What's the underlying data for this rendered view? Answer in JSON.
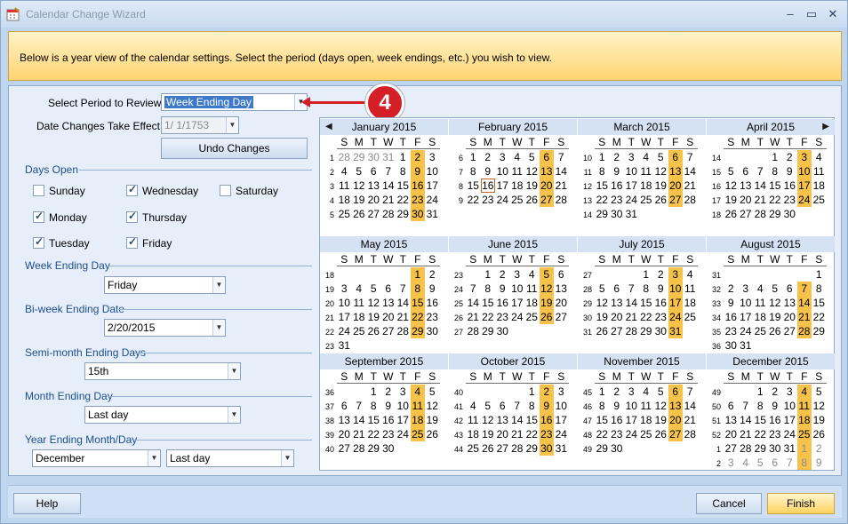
{
  "window": {
    "title": "Calendar Change Wizard",
    "controls": [
      "–",
      "▭",
      "✕"
    ]
  },
  "banner": {
    "text": "Below is a year view of the calendar settings. Select the period (days open, week endings, etc.) you wish to view."
  },
  "form": {
    "period_label": "Select Period to Review:",
    "period_value": "Week Ending Day",
    "effect_label": "Date Changes Take Effect:",
    "effect_value": "1/  1/1753",
    "undo_label": "Undo Changes",
    "days_open_label": "Days Open",
    "days": [
      {
        "label": "Sunday",
        "checked": false
      },
      {
        "label": "Wednesday",
        "checked": true
      },
      {
        "label": "Saturday",
        "checked": false
      },
      {
        "label": "Monday",
        "checked": true
      },
      {
        "label": "Thursday",
        "checked": true
      },
      {
        "label": "Tuesday",
        "checked": true
      },
      {
        "label": "Friday",
        "checked": true
      }
    ],
    "week_ending_label": "Week Ending Day",
    "week_ending_value": "Friday",
    "biweek_label": "Bi-week Ending Date",
    "biweek_value": "2/20/2015",
    "semimonth_label": "Semi-month Ending Days",
    "semimonth_value": "15th",
    "month_ending_label": "Month Ending Day",
    "month_ending_value": "Last day",
    "year_ending_label": "Year Ending Month/Day",
    "year_month_value": "December",
    "year_day_value": "Last day"
  },
  "callout": {
    "number": "4"
  },
  "calendar": {
    "dow": [
      "S",
      "M",
      "T",
      "W",
      "T",
      "F",
      "S"
    ],
    "prev_icon": "◀",
    "next_icon": "▶",
    "months": [
      {
        "name": "January 2015",
        "weeks": [
          "1",
          "2",
          "3",
          "4",
          "5"
        ],
        "rows": [
          [
            "28",
            "29",
            "30",
            "31",
            "1",
            "2",
            "3"
          ],
          [
            "4",
            "5",
            "6",
            "7",
            "8",
            "9",
            "10"
          ],
          [
            "11",
            "12",
            "13",
            "14",
            "15",
            "16",
            "17"
          ],
          [
            "18",
            "19",
            "20",
            "21",
            "22",
            "23",
            "24"
          ],
          [
            "25",
            "26",
            "27",
            "28",
            "29",
            "30",
            "31"
          ]
        ],
        "other": [
          [
            0,
            0
          ],
          [
            0,
            1
          ],
          [
            0,
            2
          ],
          [
            0,
            3
          ]
        ]
      },
      {
        "name": "February 2015",
        "weeks": [
          "6",
          "7",
          "8",
          "9"
        ],
        "rows": [
          [
            "1",
            "2",
            "3",
            "4",
            "5",
            "6",
            "7"
          ],
          [
            "8",
            "9",
            "10",
            "11",
            "12",
            "13",
            "14"
          ],
          [
            "15",
            "16",
            "17",
            "18",
            "19",
            "20",
            "21"
          ],
          [
            "22",
            "23",
            "24",
            "25",
            "26",
            "27",
            "28"
          ]
        ],
        "other": [],
        "today": [
          2,
          1
        ]
      },
      {
        "name": "March 2015",
        "weeks": [
          "10",
          "11",
          "12",
          "13",
          "14"
        ],
        "rows": [
          [
            "1",
            "2",
            "3",
            "4",
            "5",
            "6",
            "7"
          ],
          [
            "8",
            "9",
            "10",
            "11",
            "12",
            "13",
            "14"
          ],
          [
            "15",
            "16",
            "17",
            "18",
            "19",
            "20",
            "21"
          ],
          [
            "22",
            "23",
            "24",
            "25",
            "26",
            "27",
            "28"
          ],
          [
            "29",
            "30",
            "31",
            "",
            "",
            "",
            ""
          ]
        ],
        "other": []
      },
      {
        "name": "April 2015",
        "weeks": [
          "14",
          "15",
          "16",
          "17",
          "18"
        ],
        "rows": [
          [
            "",
            "",
            "",
            "1",
            "2",
            "3",
            "4"
          ],
          [
            "5",
            "6",
            "7",
            "8",
            "9",
            "10",
            "11"
          ],
          [
            "12",
            "13",
            "14",
            "15",
            "16",
            "17",
            "18"
          ],
          [
            "19",
            "20",
            "21",
            "22",
            "23",
            "24",
            "25"
          ],
          [
            "26",
            "27",
            "28",
            "29",
            "30",
            "",
            ""
          ]
        ],
        "other": []
      },
      {
        "name": "May 2015",
        "weeks": [
          "18",
          "19",
          "20",
          "21",
          "22",
          "23"
        ],
        "rows": [
          [
            "",
            "",
            "",
            "",
            "",
            "1",
            "2"
          ],
          [
            "3",
            "4",
            "5",
            "6",
            "7",
            "8",
            "9"
          ],
          [
            "10",
            "11",
            "12",
            "13",
            "14",
            "15",
            "16"
          ],
          [
            "17",
            "18",
            "19",
            "20",
            "21",
            "22",
            "23"
          ],
          [
            "24",
            "25",
            "26",
            "27",
            "28",
            "29",
            "30"
          ],
          [
            "31",
            "",
            "",
            "",
            "",
            "",
            ""
          ]
        ],
        "other": []
      },
      {
        "name": "June 2015",
        "weeks": [
          "23",
          "24",
          "25",
          "26",
          "27"
        ],
        "rows": [
          [
            "",
            "1",
            "2",
            "3",
            "4",
            "5",
            "6"
          ],
          [
            "7",
            "8",
            "9",
            "10",
            "11",
            "12",
            "13"
          ],
          [
            "14",
            "15",
            "16",
            "17",
            "18",
            "19",
            "20"
          ],
          [
            "21",
            "22",
            "23",
            "24",
            "25",
            "26",
            "27"
          ],
          [
            "28",
            "29",
            "30",
            "",
            "",
            "",
            ""
          ]
        ],
        "other": []
      },
      {
        "name": "July 2015",
        "weeks": [
          "27",
          "28",
          "29",
          "30",
          "31"
        ],
        "rows": [
          [
            "",
            "",
            "",
            "1",
            "2",
            "3",
            "4"
          ],
          [
            "5",
            "6",
            "7",
            "8",
            "9",
            "10",
            "11"
          ],
          [
            "12",
            "13",
            "14",
            "15",
            "16",
            "17",
            "18"
          ],
          [
            "19",
            "20",
            "21",
            "22",
            "23",
            "24",
            "25"
          ],
          [
            "26",
            "27",
            "28",
            "29",
            "30",
            "31",
            ""
          ]
        ],
        "other": []
      },
      {
        "name": "August 2015",
        "weeks": [
          "31",
          "32",
          "33",
          "34",
          "35",
          "36"
        ],
        "rows": [
          [
            "",
            "",
            "",
            "",
            "",
            "",
            "1"
          ],
          [
            "2",
            "3",
            "4",
            "5",
            "6",
            "7",
            "8"
          ],
          [
            "9",
            "10",
            "11",
            "12",
            "13",
            "14",
            "15"
          ],
          [
            "16",
            "17",
            "18",
            "19",
            "20",
            "21",
            "22"
          ],
          [
            "23",
            "24",
            "25",
            "26",
            "27",
            "28",
            "29"
          ],
          [
            "30",
            "31",
            "",
            "",
            "",
            "",
            ""
          ]
        ],
        "other": []
      },
      {
        "name": "September 2015",
        "weeks": [
          "36",
          "37",
          "38",
          "39",
          "40"
        ],
        "rows": [
          [
            "",
            "",
            "1",
            "2",
            "3",
            "4",
            "5"
          ],
          [
            "6",
            "7",
            "8",
            "9",
            "10",
            "11",
            "12"
          ],
          [
            "13",
            "14",
            "15",
            "16",
            "17",
            "18",
            "19"
          ],
          [
            "20",
            "21",
            "22",
            "23",
            "24",
            "25",
            "26"
          ],
          [
            "27",
            "28",
            "29",
            "30",
            "",
            "",
            ""
          ]
        ],
        "other": []
      },
      {
        "name": "October 2015",
        "weeks": [
          "40",
          "41",
          "42",
          "43",
          "44"
        ],
        "rows": [
          [
            "",
            "",
            "",
            "",
            "1",
            "2",
            "3"
          ],
          [
            "4",
            "5",
            "6",
            "7",
            "8",
            "9",
            "10"
          ],
          [
            "11",
            "12",
            "13",
            "14",
            "15",
            "16",
            "17"
          ],
          [
            "18",
            "19",
            "20",
            "21",
            "22",
            "23",
            "24"
          ],
          [
            "25",
            "26",
            "27",
            "28",
            "29",
            "30",
            "31"
          ]
        ],
        "other": []
      },
      {
        "name": "November 2015",
        "weeks": [
          "45",
          "46",
          "47",
          "48",
          "49"
        ],
        "rows": [
          [
            "1",
            "2",
            "3",
            "4",
            "5",
            "6",
            "7"
          ],
          [
            "8",
            "9",
            "10",
            "11",
            "12",
            "13",
            "14"
          ],
          [
            "15",
            "16",
            "17",
            "18",
            "19",
            "20",
            "21"
          ],
          [
            "22",
            "23",
            "24",
            "25",
            "26",
            "27",
            "28"
          ],
          [
            "29",
            "30",
            "",
            "",
            "",
            "",
            ""
          ]
        ],
        "other": []
      },
      {
        "name": "December 2015",
        "weeks": [
          "49",
          "50",
          "51",
          "52",
          "1",
          "2"
        ],
        "rows": [
          [
            "",
            "",
            "1",
            "2",
            "3",
            "4",
            "5"
          ],
          [
            "6",
            "7",
            "8",
            "9",
            "10",
            "11",
            "12"
          ],
          [
            "13",
            "14",
            "15",
            "16",
            "17",
            "18",
            "19"
          ],
          [
            "20",
            "21",
            "22",
            "23",
            "24",
            "25",
            "26"
          ],
          [
            "27",
            "28",
            "29",
            "30",
            "31",
            "1",
            "2"
          ],
          [
            "3",
            "4",
            "5",
            "6",
            "7",
            "8",
            "9"
          ]
        ],
        "other": [
          [
            4,
            5
          ],
          [
            4,
            6
          ],
          [
            5,
            0
          ],
          [
            5,
            1
          ],
          [
            5,
            2
          ],
          [
            5,
            3
          ],
          [
            5,
            4
          ],
          [
            5,
            5
          ],
          [
            5,
            6
          ]
        ]
      }
    ]
  },
  "footer": {
    "help": "Help",
    "cancel": "Cancel",
    "finish": "Finish"
  },
  "colors": {
    "highlight": "#f7c24a",
    "banner": "#ffd472",
    "accent": "#3e79c9"
  }
}
